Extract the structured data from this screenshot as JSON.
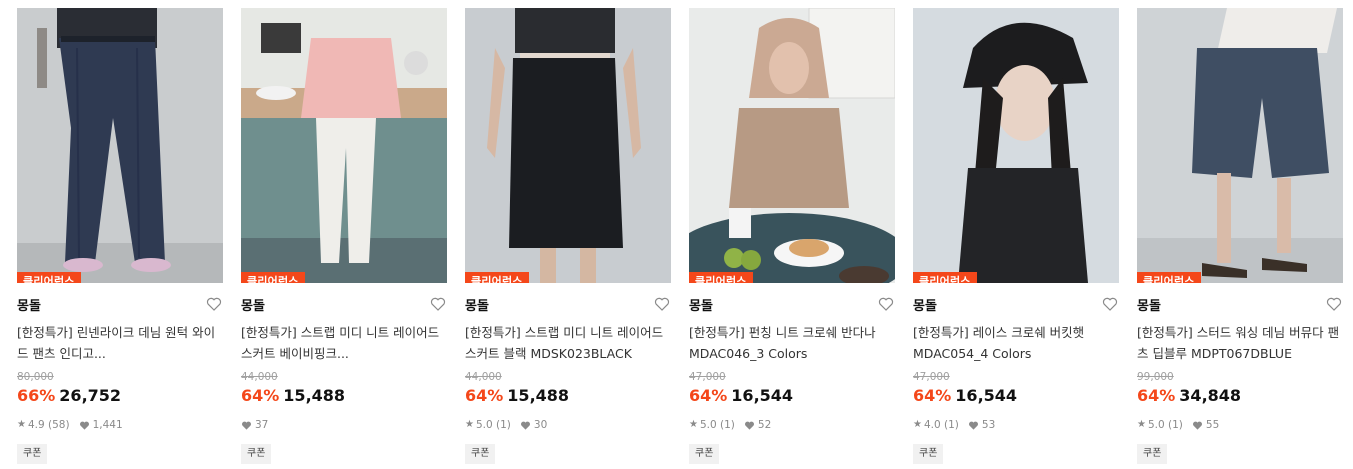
{
  "colors": {
    "accent": "#f4471a",
    "text": "#111111",
    "muted": "#8a8a8a"
  },
  "products": [
    {
      "badge": "클리어런스",
      "brand": "몽돌",
      "title": "[한정특가] 린넨라이크 데님 원턱 와이드 팬츠 인디고...",
      "original_price": "80,000",
      "discount": "66%",
      "price": "26,752",
      "rating": "4.9",
      "reviews": "(58)",
      "likes": "1,441",
      "coupon": "쿠폰",
      "image": "model-in-indigo-wide-denim-pants"
    },
    {
      "badge": "클리어런스",
      "brand": "몽돌",
      "title": "[한정특가] 스트랩 미디 니트 레이어드 스커트 베이비핑크...",
      "original_price": "44,000",
      "discount": "64%",
      "price": "15,488",
      "rating": "",
      "reviews": "",
      "likes": "37",
      "coupon": "쿠폰",
      "image": "model-on-kitchen-counter-pink-knit-skirt"
    },
    {
      "badge": "클리어런스",
      "brand": "몽돌",
      "title": "[한정특가] 스트랩 미디 니트 레이어드 스커트 블랙 MDSK023BLACK",
      "original_price": "44,000",
      "discount": "64%",
      "price": "15,488",
      "rating": "5.0",
      "reviews": "(1)",
      "likes": "30",
      "coupon": "쿠폰",
      "image": "model-in-black-knit-midi-skirt"
    },
    {
      "badge": "클리어런스",
      "brand": "몽돌",
      "title": "[한정특가] 펀칭 니트 크로쉐 반다나 MDAC046_3 Colors",
      "original_price": "47,000",
      "discount": "64%",
      "price": "16,544",
      "rating": "5.0",
      "reviews": "(1)",
      "likes": "52",
      "coupon": "쿠폰",
      "image": "model-in-crochet-bandana-at-table"
    },
    {
      "badge": "클리어런스",
      "brand": "몽돌",
      "title": "[한정특가] 레이스 크로쉐 버킷햇 MDAC054_4 Colors",
      "original_price": "47,000",
      "discount": "64%",
      "price": "16,544",
      "rating": "4.0",
      "reviews": "(1)",
      "likes": "53",
      "coupon": "쿠폰",
      "image": "model-in-black-crochet-bucket-hat"
    },
    {
      "badge": "클리어런스",
      "brand": "몽돌",
      "title": "[한정특가] 스터드 워싱 데님 버뮤다 팬츠 딥블루 MDPT067DBLUE",
      "original_price": "99,000",
      "discount": "64%",
      "price": "34,848",
      "rating": "5.0",
      "reviews": "(1)",
      "likes": "55",
      "coupon": "쿠폰",
      "image": "model-in-washed-denim-bermuda-shorts"
    }
  ]
}
